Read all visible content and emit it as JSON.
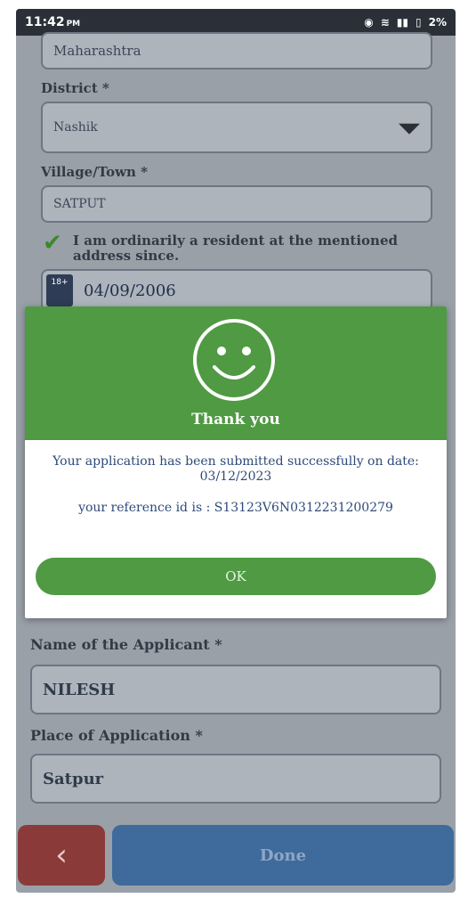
{
  "status_bar": {
    "time": "11:42",
    "ampm": "PM",
    "battery": "2%"
  },
  "form": {
    "state_value": "Maharashtra",
    "district_label": "District *",
    "district_value": "Nashik",
    "village_label": "Village/Town *",
    "village_value": "SATPUT",
    "resident_text": "I am ordinarily a resident at the mentioned address since.",
    "calendar_badge": "18+",
    "resident_date": "04/09/2006",
    "applicant_label": "Name of the Applicant *",
    "applicant_value": "NILESH",
    "place_label": "Place of Application *",
    "place_value": "Satpur"
  },
  "dialog": {
    "title": "Thank you",
    "message": "Your application has been submitted successfully on date: 03/12/2023",
    "reference": "your reference id is : S13123V6N0312231200279",
    "ok_label": "OK"
  },
  "bottom_bar": {
    "back_icon": "chevron-left-icon",
    "done_label": "Done"
  },
  "colors": {
    "accent_green": "#4f9a43",
    "done_blue": "#3f6a9c",
    "back_red": "#8b3a3a"
  }
}
